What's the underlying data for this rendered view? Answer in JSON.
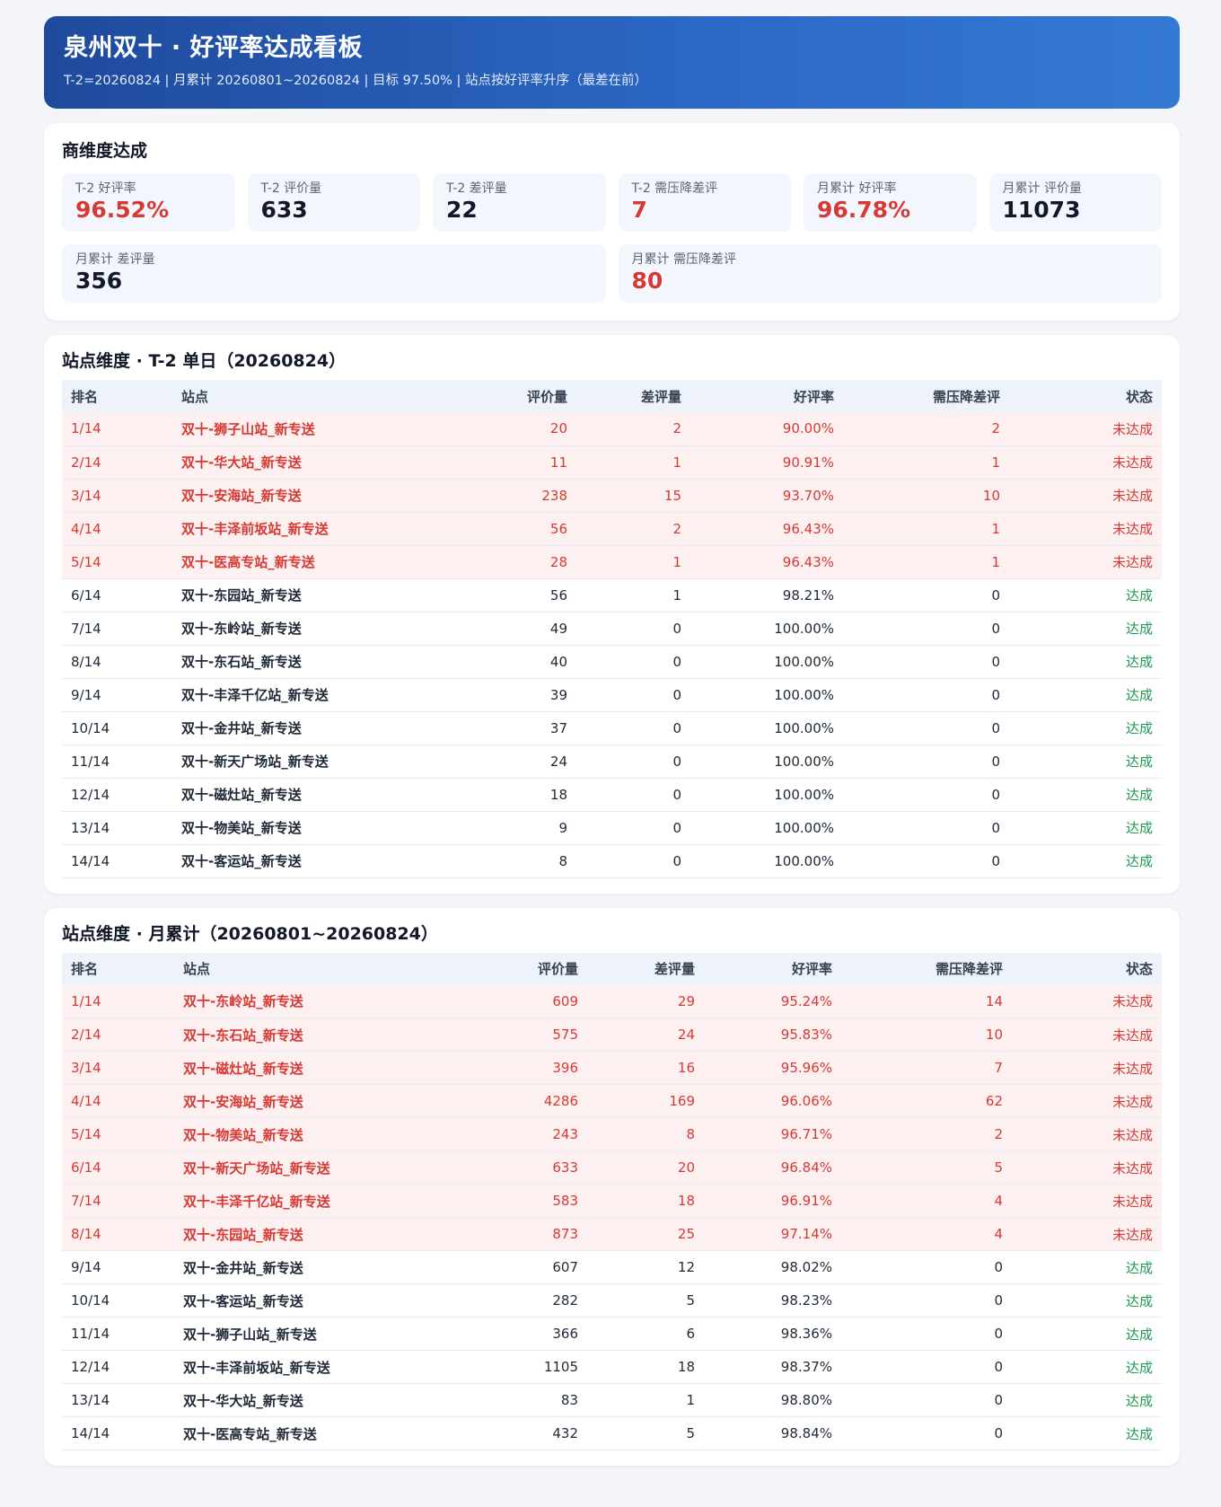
{
  "header": {
    "title": "泉州双十 · 好评率达成看板",
    "subtitle": "T-2=20260824  |  月累计 20260801~20260824  |  目标 97.50%  |  站点按好评率升序（最差在前）"
  },
  "merchant": {
    "title": "商维度达成",
    "kpis": [
      {
        "label": "T-2 好评率",
        "value": "96.52%",
        "alert": true
      },
      {
        "label": "T-2 评价量",
        "value": "633",
        "alert": false
      },
      {
        "label": "T-2 差评量",
        "value": "22",
        "alert": false
      },
      {
        "label": "T-2 需压降差评",
        "value": "7",
        "alert": true
      },
      {
        "label": "月累计 好评率",
        "value": "96.78%",
        "alert": true
      },
      {
        "label": "月累计 评价量",
        "value": "11073",
        "alert": false
      },
      {
        "label": "月累计 差评量",
        "value": "356",
        "alert": false
      },
      {
        "label": "月累计 需压降差评",
        "value": "80",
        "alert": true
      }
    ]
  },
  "columns": [
    "排名",
    "站点",
    "评价量",
    "差评量",
    "好评率",
    "需压降差评",
    "状态"
  ],
  "daily": {
    "title": "站点维度 · T-2 单日（20260824）",
    "rows": [
      [
        "1/14",
        "双十-狮子山站_新专送",
        "20",
        "2",
        "90.00%",
        "2",
        "未达成"
      ],
      [
        "2/14",
        "双十-华大站_新专送",
        "11",
        "1",
        "90.91%",
        "1",
        "未达成"
      ],
      [
        "3/14",
        "双十-安海站_新专送",
        "238",
        "15",
        "93.70%",
        "10",
        "未达成"
      ],
      [
        "4/14",
        "双十-丰泽前坂站_新专送",
        "56",
        "2",
        "96.43%",
        "1",
        "未达成"
      ],
      [
        "5/14",
        "双十-医高专站_新专送",
        "28",
        "1",
        "96.43%",
        "1",
        "未达成"
      ],
      [
        "6/14",
        "双十-东园站_新专送",
        "56",
        "1",
        "98.21%",
        "0",
        "达成"
      ],
      [
        "7/14",
        "双十-东岭站_新专送",
        "49",
        "0",
        "100.00%",
        "0",
        "达成"
      ],
      [
        "8/14",
        "双十-东石站_新专送",
        "40",
        "0",
        "100.00%",
        "0",
        "达成"
      ],
      [
        "9/14",
        "双十-丰泽千亿站_新专送",
        "39",
        "0",
        "100.00%",
        "0",
        "达成"
      ],
      [
        "10/14",
        "双十-金井站_新专送",
        "37",
        "0",
        "100.00%",
        "0",
        "达成"
      ],
      [
        "11/14",
        "双十-新天广场站_新专送",
        "24",
        "0",
        "100.00%",
        "0",
        "达成"
      ],
      [
        "12/14",
        "双十-磁灶站_新专送",
        "18",
        "0",
        "100.00%",
        "0",
        "达成"
      ],
      [
        "13/14",
        "双十-物美站_新专送",
        "9",
        "0",
        "100.00%",
        "0",
        "达成"
      ],
      [
        "14/14",
        "双十-客运站_新专送",
        "8",
        "0",
        "100.00%",
        "0",
        "达成"
      ]
    ]
  },
  "monthly": {
    "title": "站点维度 · 月累计（20260801~20260824）",
    "rows": [
      [
        "1/14",
        "双十-东岭站_新专送",
        "609",
        "29",
        "95.24%",
        "14",
        "未达成"
      ],
      [
        "2/14",
        "双十-东石站_新专送",
        "575",
        "24",
        "95.83%",
        "10",
        "未达成"
      ],
      [
        "3/14",
        "双十-磁灶站_新专送",
        "396",
        "16",
        "95.96%",
        "7",
        "未达成"
      ],
      [
        "4/14",
        "双十-安海站_新专送",
        "4286",
        "169",
        "96.06%",
        "62",
        "未达成"
      ],
      [
        "5/14",
        "双十-物美站_新专送",
        "243",
        "8",
        "96.71%",
        "2",
        "未达成"
      ],
      [
        "6/14",
        "双十-新天广场站_新专送",
        "633",
        "20",
        "96.84%",
        "5",
        "未达成"
      ],
      [
        "7/14",
        "双十-丰泽千亿站_新专送",
        "583",
        "18",
        "96.91%",
        "4",
        "未达成"
      ],
      [
        "8/14",
        "双十-东园站_新专送",
        "873",
        "25",
        "97.14%",
        "4",
        "未达成"
      ],
      [
        "9/14",
        "双十-金井站_新专送",
        "607",
        "12",
        "98.02%",
        "0",
        "达成"
      ],
      [
        "10/14",
        "双十-客运站_新专送",
        "282",
        "5",
        "98.23%",
        "0",
        "达成"
      ],
      [
        "11/14",
        "双十-狮子山站_新专送",
        "366",
        "6",
        "98.36%",
        "0",
        "达成"
      ],
      [
        "12/14",
        "双十-丰泽前坂站_新专送",
        "1105",
        "18",
        "98.37%",
        "0",
        "达成"
      ],
      [
        "13/14",
        "双十-华大站_新专送",
        "83",
        "1",
        "98.80%",
        "0",
        "达成"
      ],
      [
        "14/14",
        "双十-医高专站_新专送",
        "432",
        "5",
        "98.84%",
        "0",
        "达成"
      ]
    ]
  },
  "colors": {
    "alert": "#d63a35",
    "ok": "#1f9a55",
    "alert_row_bg": "#fdf0f0"
  }
}
